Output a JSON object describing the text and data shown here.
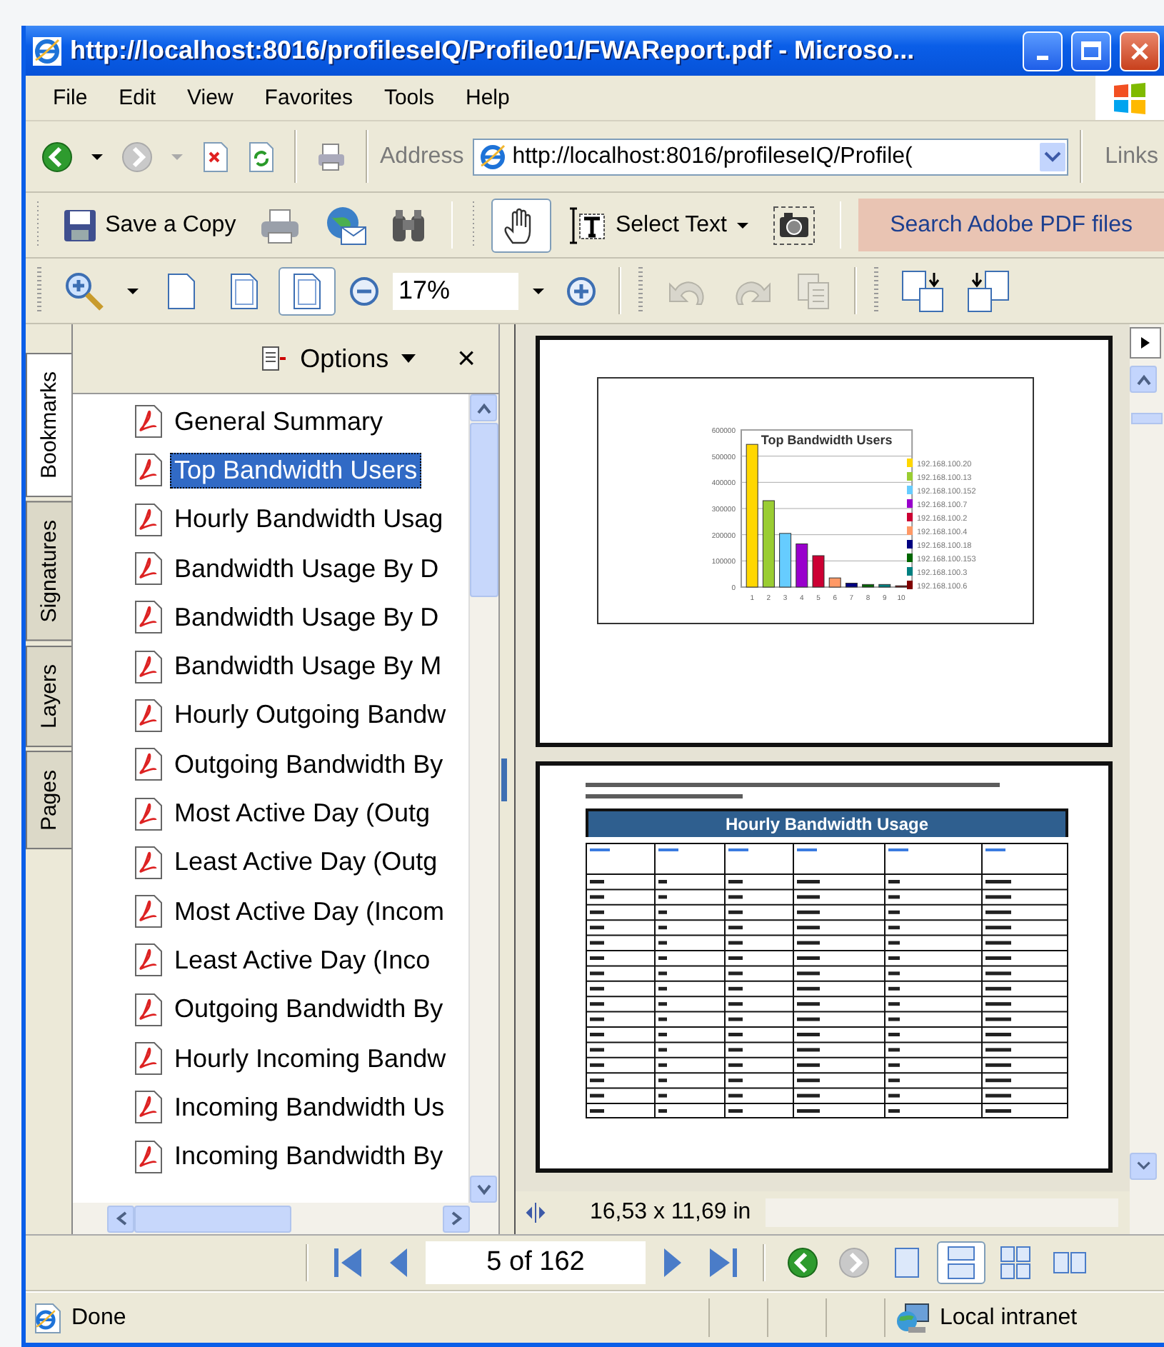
{
  "window": {
    "title": "http://localhost:8016/profileseIQ/Profile01/FWAReport.pdf - Microso..."
  },
  "menu": [
    "File",
    "Edit",
    "View",
    "Favorites",
    "Tools",
    "Help"
  ],
  "address_bar": {
    "label": "Address",
    "value": "http://localhost:8016/profileseIQ/Profile(",
    "links": "Links"
  },
  "acrobat_toolbar": {
    "save_copy": "Save a Copy",
    "hand_tool_selected": true,
    "select_text": "Select Text",
    "search": "Search Adobe PDF files"
  },
  "zoom_toolbar": {
    "zoom": "17%",
    "fit_buttons": [
      {
        "selected": false
      },
      {
        "selected": false
      },
      {
        "selected": true
      }
    ]
  },
  "side_tabs": [
    {
      "label": "Bookmarks",
      "selected": true
    },
    {
      "label": "Signatures",
      "selected": false
    },
    {
      "label": "Layers",
      "selected": false
    },
    {
      "label": "Pages",
      "selected": false
    }
  ],
  "bookmarks": {
    "options": "Options",
    "close": "×",
    "items": [
      {
        "label": "General Summary",
        "selected": false
      },
      {
        "label": "Top Bandwidth Users",
        "selected": true
      },
      {
        "label": "Hourly Bandwidth Usag",
        "selected": false
      },
      {
        "label": "Bandwidth Usage By D",
        "selected": false
      },
      {
        "label": "Bandwidth Usage By D",
        "selected": false
      },
      {
        "label": "Bandwidth Usage By M",
        "selected": false
      },
      {
        "label": "Hourly Outgoing Bandw",
        "selected": false
      },
      {
        "label": "Outgoing Bandwidth By",
        "selected": false
      },
      {
        "label": "Most Active Day (Outg",
        "selected": false
      },
      {
        "label": "Least Active Day (Outg",
        "selected": false
      },
      {
        "label": "Most Active Day (Incom",
        "selected": false
      },
      {
        "label": "Least Active Day (Inco",
        "selected": false
      },
      {
        "label": "Outgoing Bandwidth By",
        "selected": false
      },
      {
        "label": "Hourly Incoming Bandw",
        "selected": false
      },
      {
        "label": "Incoming Bandwidth Us",
        "selected": false
      },
      {
        "label": "Incoming Bandwidth By",
        "selected": false
      }
    ]
  },
  "document": {
    "chart_page": {
      "chart_data": {
        "type": "bar",
        "title": "Top Bandwidth Users",
        "categories": [
          "1",
          "2",
          "3",
          "4",
          "5",
          "6",
          "7",
          "8",
          "9",
          "10"
        ],
        "values": [
          545000,
          330000,
          205000,
          165000,
          120000,
          35000,
          15000,
          10000,
          10000,
          5000
        ],
        "ylim": [
          0,
          600000
        ],
        "grid": true,
        "yticks": [
          0,
          100000,
          200000,
          300000,
          400000,
          500000,
          600000
        ]
      },
      "legend": [
        {
          "label": "192.168.100.20",
          "color": "#ffd700"
        },
        {
          "label": "192.168.100.13",
          "color": "#9acd32"
        },
        {
          "label": "192.168.100.152",
          "color": "#66ccff"
        },
        {
          "label": "192.168.100.7",
          "color": "#9900cc"
        },
        {
          "label": "192.168.100.2",
          "color": "#cc0033"
        },
        {
          "label": "192.168.100.4",
          "color": "#ff9966"
        },
        {
          "label": "192.168.100.18",
          "color": "#000080"
        },
        {
          "label": "192.168.100.153",
          "color": "#006600"
        },
        {
          "label": "192.168.100.3",
          "color": "#008080"
        },
        {
          "label": "192.168.100.6",
          "color": "#800000"
        }
      ]
    },
    "table_page": {
      "title": "Hourly Bandwidth Usage"
    },
    "page_size": "16,53 x 11,69 in"
  },
  "navigation": {
    "page": "5 of 162",
    "layouts": [
      {
        "selected": false
      },
      {
        "selected": true
      },
      {
        "selected": false
      },
      {
        "selected": false
      }
    ]
  },
  "status_bar": {
    "text": "Done",
    "zone": "Local intranet"
  }
}
